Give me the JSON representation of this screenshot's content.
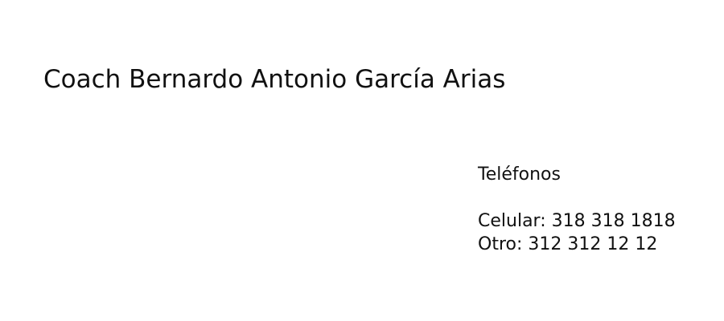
{
  "card": {
    "name": "Coach Bernardo Antonio García Arias"
  },
  "phones": {
    "heading": "Teléfonos",
    "mobile": "Celular: 318 318 1818",
    "other": "Otro: 312 312 12 12"
  }
}
